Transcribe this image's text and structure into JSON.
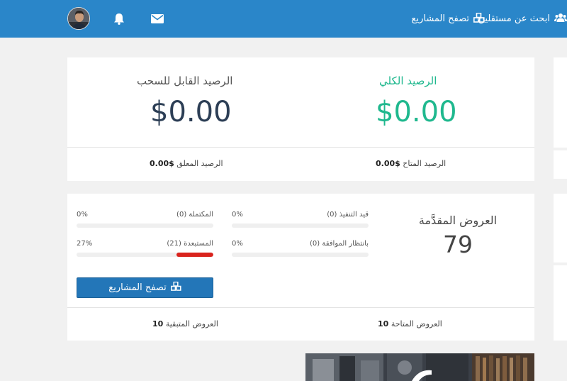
{
  "nav": {
    "find_freelancers": "ابحث عن مستقلين",
    "browse_projects": "تصفح المشاريع",
    "icons": [
      "users-icon",
      "cubes-icon",
      "envelope-icon",
      "bell-icon",
      "avatar"
    ]
  },
  "balance": {
    "total_label": "الرصيد الكلي",
    "total_amount": "$0.00",
    "withdrawable_label": "الرصيد القابل للسحب",
    "withdrawable_amount": "$0.00",
    "available_label": "الرصيد المتاح",
    "available_value": "$0.00",
    "pending_label": "الرصيد المعلق",
    "pending_value": "$0.00"
  },
  "offers": {
    "title": "العروض المقدَّمة",
    "count": "79",
    "in_progress": {
      "label": "قيد التنفيذ (0)",
      "percent": "0%",
      "fraction": 0
    },
    "completed": {
      "label": "المكتملة (0)",
      "percent": "0%",
      "fraction": 0
    },
    "awaiting": {
      "label": "بانتظار الموافقة (0)",
      "percent": "0%",
      "fraction": 0
    },
    "excluded": {
      "label": "المستبعدة (21)",
      "percent": "27%",
      "fraction": 0.27
    },
    "browse_button": "تصفح المشاريع",
    "available_label": "العروض المتاحة",
    "available_value": "10",
    "remaining_label": "العروض المتبقية",
    "remaining_value": "10"
  },
  "colors": {
    "topbar": "#2a86c9",
    "accent_green": "#1fb88e",
    "button_blue": "#2376b8",
    "progress_red": "#d9231d"
  }
}
